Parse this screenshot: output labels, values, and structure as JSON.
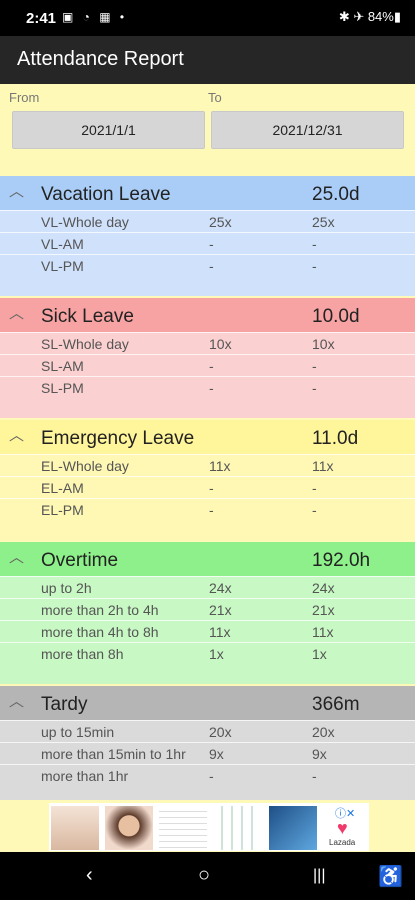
{
  "status": {
    "time": "2:41",
    "left_icons": "▣ ◔ ▦ •",
    "right_icons": "✱ ✈ 84%▮"
  },
  "app": {
    "title": "Attendance Report"
  },
  "range": {
    "from_label": "From",
    "to_label": "To",
    "from_value": "2021/1/1",
    "to_value": "2021/12/31"
  },
  "sections": [
    {
      "name": "Vacation Leave",
      "total": "25.0d",
      "rows": [
        {
          "label": "VL-Whole day",
          "c2": "25x",
          "c3": "25x"
        },
        {
          "label": "VL-AM",
          "c2": "-",
          "c3": "-"
        },
        {
          "label": "VL-PM",
          "c2": "-",
          "c3": "-"
        }
      ]
    },
    {
      "name": "Sick Leave",
      "total": "10.0d",
      "rows": [
        {
          "label": "SL-Whole day",
          "c2": "10x",
          "c3": "10x"
        },
        {
          "label": "SL-AM",
          "c2": "-",
          "c3": "-"
        },
        {
          "label": "SL-PM",
          "c2": "-",
          "c3": "-"
        }
      ]
    },
    {
      "name": "Emergency Leave",
      "total": "11.0d",
      "rows": [
        {
          "label": "EL-Whole day",
          "c2": "11x",
          "c3": "11x"
        },
        {
          "label": "EL-AM",
          "c2": "-",
          "c3": "-"
        },
        {
          "label": "EL-PM",
          "c2": "-",
          "c3": "-"
        }
      ]
    },
    {
      "name": "Overtime",
      "total": "192.0h",
      "rows": [
        {
          "label": "up to 2h",
          "c2": "24x",
          "c3": "24x"
        },
        {
          "label": "more than 2h to 4h",
          "c2": "21x",
          "c3": "21x"
        },
        {
          "label": "more than 4h to 8h",
          "c2": "11x",
          "c3": "11x"
        },
        {
          "label": "more than 8h",
          "c2": "1x",
          "c3": "1x"
        }
      ]
    },
    {
      "name": "Tardy",
      "total": "366m",
      "rows": [
        {
          "label": "up to 15min",
          "c2": "20x",
          "c3": "20x"
        },
        {
          "label": "more than 15min to 1hr",
          "c2": "9x",
          "c3": "9x"
        },
        {
          "label": "more than 1hr",
          "c2": "-",
          "c3": "-"
        }
      ]
    }
  ],
  "colors": {
    "vacation": {
      "head": "#a9cdf6",
      "body": "#cfe1fb"
    },
    "sick": {
      "head": "#f7a3a3",
      "body": "#fbd0d0"
    },
    "emergency": {
      "head": "#fff59a",
      "body": "#fff8b4"
    },
    "overtime": {
      "head": "#8ef08a",
      "body": "#c8f8c4"
    },
    "tardy": {
      "head": "#b5b5b5",
      "body": "#dadada"
    }
  },
  "ad": {
    "brand": "Lazada"
  },
  "nav": {
    "back": "‹",
    "home": "○",
    "recents": "|||",
    "a11y": "♿"
  }
}
